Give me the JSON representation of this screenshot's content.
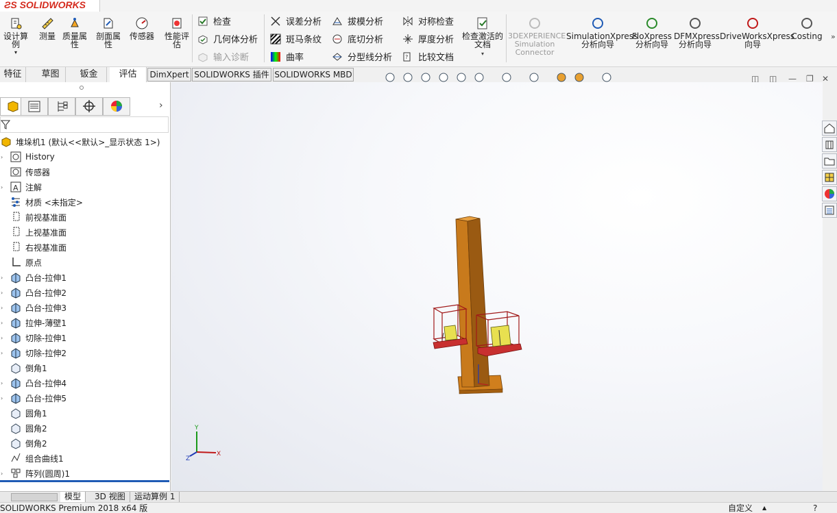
{
  "app": {
    "logo_text": "SOLIDWORKS"
  },
  "ribbon": {
    "large_buttons": [
      {
        "label": "设计算例",
        "icon": "design-study-icon"
      },
      {
        "label": "测量",
        "icon": "measure-icon"
      },
      {
        "label": "质量属性",
        "icon": "mass-properties-icon"
      },
      {
        "label": "剖面属性",
        "icon": "section-properties-icon"
      },
      {
        "label": "传感器",
        "icon": "sensor-icon"
      },
      {
        "label": "性能评估",
        "icon": "performance-evaluation-icon"
      }
    ],
    "group1": [
      {
        "label": "检查",
        "icon": "check-icon",
        "disabled": false
      },
      {
        "label": "几何体分析",
        "icon": "geometry-analysis-icon",
        "disabled": false
      },
      {
        "label": "输入诊断",
        "icon": "import-diagnostics-icon",
        "disabled": true
      }
    ],
    "group2": [
      {
        "label": "误差分析",
        "icon": "deviation-analysis-icon"
      },
      {
        "label": "斑马条纹",
        "icon": "zebra-stripes-icon"
      },
      {
        "label": "曲率",
        "icon": "curvature-icon"
      }
    ],
    "group3": [
      {
        "label": "拔模分析",
        "icon": "draft-analysis-icon"
      },
      {
        "label": "底切分析",
        "icon": "undercut-analysis-icon"
      },
      {
        "label": "分型线分析",
        "icon": "parting-line-analysis-icon"
      }
    ],
    "group4": [
      {
        "label": "对称检查",
        "icon": "symmetry-check-icon"
      },
      {
        "label": "厚度分析",
        "icon": "thickness-analysis-icon"
      },
      {
        "label": "比较文档",
        "icon": "compare-documents-icon"
      }
    ],
    "check_active": "检查激活的文档",
    "addins": [
      {
        "label": "3DEXPERIENCE Simulation Connector",
        "disabled": true
      },
      {
        "label": "SimulationXpress 分析向导",
        "disabled": false
      },
      {
        "label": "FloXpress 分析向导",
        "disabled": false
      },
      {
        "label": "DFMXpress 分析向导",
        "disabled": false
      },
      {
        "label": "DriveWorksXpress 向导",
        "disabled": false
      },
      {
        "label": "Costing",
        "disabled": false
      }
    ]
  },
  "tabs": [
    "特征",
    "草图",
    "钣金",
    "评估",
    "DimXpert",
    "SOLIDWORKS 插件",
    "SOLIDWORKS MBD"
  ],
  "active_tab": "评估",
  "feature_tree": {
    "root": "堆垛机1  (默认<<默认>_显示状态 1>)",
    "items": [
      {
        "label": "History",
        "icon": "history-icon",
        "expandable": true
      },
      {
        "label": "传感器",
        "icon": "sensor-folder-icon",
        "expandable": false
      },
      {
        "label": "注解",
        "icon": "annotations-icon",
        "expandable": true
      },
      {
        "label": "材质 <未指定>",
        "icon": "material-icon",
        "expandable": false
      },
      {
        "label": "前视基准面",
        "icon": "plane-icon",
        "expandable": false
      },
      {
        "label": "上视基准面",
        "icon": "plane-icon",
        "expandable": false
      },
      {
        "label": "右视基准面",
        "icon": "plane-icon",
        "expandable": false
      },
      {
        "label": "原点",
        "icon": "origin-icon",
        "expandable": false
      },
      {
        "label": "凸台-拉伸1",
        "icon": "extrude-icon",
        "expandable": true
      },
      {
        "label": "凸台-拉伸2",
        "icon": "extrude-icon",
        "expandable": true
      },
      {
        "label": "凸台-拉伸3",
        "icon": "extrude-icon",
        "expandable": true
      },
      {
        "label": "拉伸-薄壁1",
        "icon": "thin-extrude-icon",
        "expandable": true
      },
      {
        "label": "切除-拉伸1",
        "icon": "cut-extrude-icon",
        "expandable": true
      },
      {
        "label": "切除-拉伸2",
        "icon": "cut-extrude-icon",
        "expandable": true
      },
      {
        "label": "倒角1",
        "icon": "chamfer-icon",
        "expandable": false
      },
      {
        "label": "凸台-拉伸4",
        "icon": "extrude-icon",
        "expandable": true
      },
      {
        "label": "凸台-拉伸5",
        "icon": "extrude-icon",
        "expandable": true
      },
      {
        "label": "圆角1",
        "icon": "fillet-icon",
        "expandable": false
      },
      {
        "label": "圆角2",
        "icon": "fillet-icon",
        "expandable": false
      },
      {
        "label": "倒角2",
        "icon": "chamfer-icon",
        "expandable": false
      },
      {
        "label": "组合曲线1",
        "icon": "composite-curve-icon",
        "expandable": false
      },
      {
        "label": "阵列(圆周)1",
        "icon": "circular-pattern-icon",
        "expandable": true
      }
    ]
  },
  "bottom_tabs": [
    "模型",
    "3D 视图",
    "运动算例 1"
  ],
  "status": {
    "left": "SOLIDWORKS Premium 2018 x64 版",
    "right": "自定义"
  },
  "triad": {
    "x": "X",
    "y": "Y",
    "z": "Z"
  },
  "colors": {
    "accent_blue": "#1f5bb5",
    "model_orange": "#c87a1c",
    "frame_red": "#b02020"
  }
}
